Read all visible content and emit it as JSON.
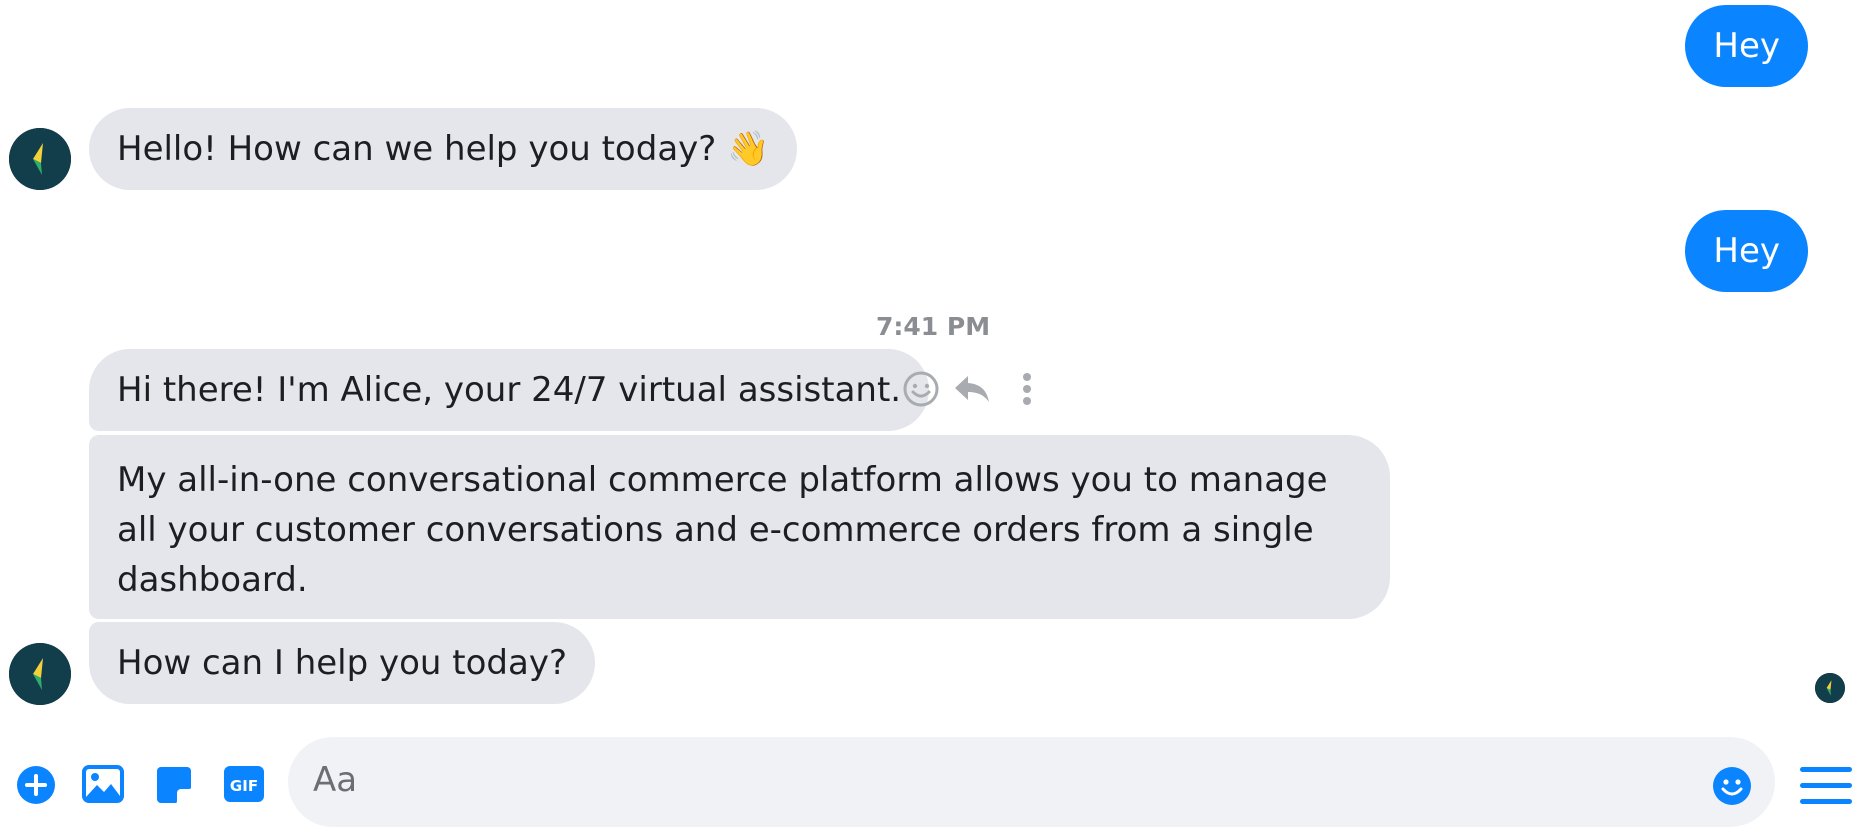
{
  "messages": [
    {
      "direction": "out",
      "text": "Hey"
    },
    {
      "direction": "in",
      "text": "Hello! How can we help you today? 👋"
    },
    {
      "direction": "out",
      "text": "Hey"
    },
    {
      "direction": "in",
      "text": "Hi there! I'm Alice, your 24/7 virtual assistant."
    },
    {
      "direction": "in",
      "text": "My all-in-one conversational commerce platform allows you to manage all your customer conversations and e-commerce orders from a single dashboard."
    },
    {
      "direction": "in",
      "text": "How can I help you today?"
    }
  ],
  "timestamp": "7:41 PM",
  "message_actions": {
    "icons": [
      "smiley-react-icon",
      "reply-icon",
      "more-options-icon"
    ]
  },
  "composer": {
    "placeholder": "Aa",
    "icons": [
      "plus-icon",
      "photo-icon",
      "sticker-icon",
      "gif-icon",
      "emoji-icon",
      "menu-icon"
    ],
    "gif_label": "GIF"
  },
  "colors": {
    "outgoing_bubble": "#0a84ff",
    "incoming_bubble": "#e4e6eb",
    "accent": "#0a84ff",
    "avatar_bg": "#123d4a",
    "timestamp": "#8a8d91"
  }
}
